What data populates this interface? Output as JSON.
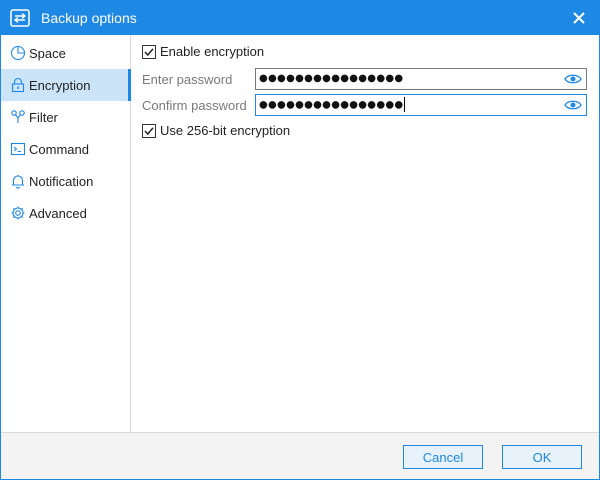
{
  "window": {
    "title": "Backup options",
    "accent_color": "#1e88e5",
    "icons": {
      "app": "transfer-arrows-icon",
      "close": "close-icon"
    }
  },
  "sidebar": {
    "items": [
      {
        "label": "Space",
        "icon": "pie-chart-icon",
        "active": false
      },
      {
        "label": "Encryption",
        "icon": "lock-icon",
        "active": true
      },
      {
        "label": "Filter",
        "icon": "filter-icon",
        "active": false
      },
      {
        "label": "Command",
        "icon": "terminal-icon",
        "active": false
      },
      {
        "label": "Notification",
        "icon": "bell-icon",
        "active": false
      },
      {
        "label": "Advanced",
        "icon": "gear-icon",
        "active": false
      }
    ]
  },
  "encryption": {
    "enable_label": "Enable encryption",
    "enable_checked": true,
    "enter_password_label": "Enter password",
    "enter_password_value": "●●●●●●●●●●●●●●●●",
    "confirm_password_label": "Confirm password",
    "confirm_password_value": "●●●●●●●●●●●●●●●●",
    "aes256_label": "Use 256-bit encryption",
    "aes256_checked": true,
    "show_password_icon": "eye-icon"
  },
  "footer": {
    "cancel_label": "Cancel",
    "ok_label": "OK"
  }
}
